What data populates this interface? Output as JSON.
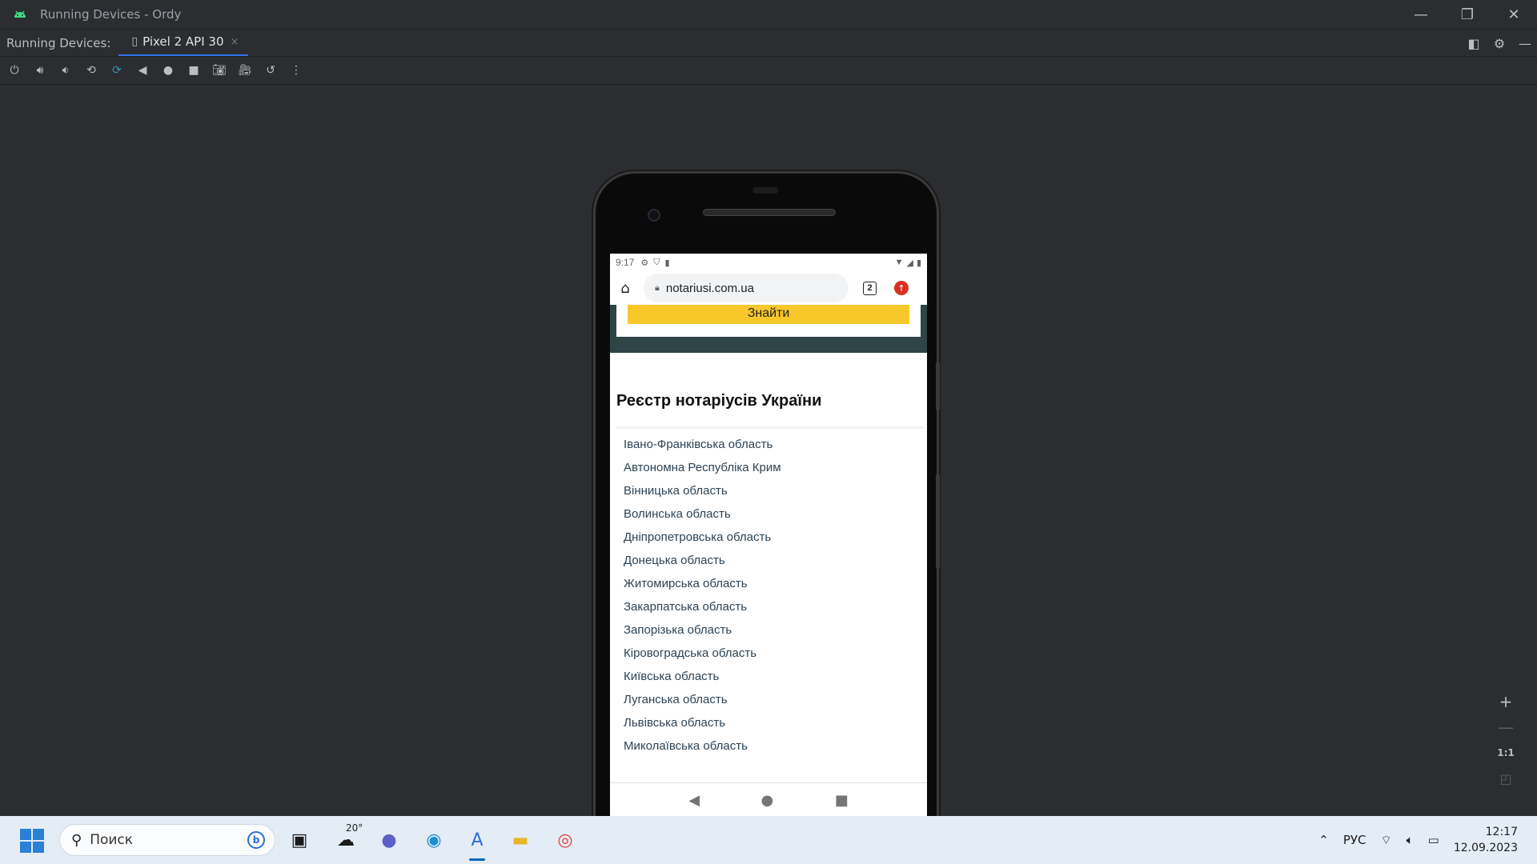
{
  "window": {
    "title": "Running Devices - Ordy",
    "minimize": "—",
    "restore": "❐",
    "close": "✕"
  },
  "tabbar": {
    "label": "Running Devices:",
    "tab_label": "Pixel 2 API 30",
    "tab_close": "×"
  },
  "phone": {
    "status_time": "9:17",
    "url": "notariusi.com.ua",
    "tabs_count": "2",
    "search_button": "Знайти",
    "registry_title": "Реєстр нотаріусів України",
    "regions": [
      "Івано-Франківська область",
      "Автономна Республіка Крим",
      "Вінницька область",
      "Волинська область",
      "Дніпропетровська область",
      "Донецька область",
      "Житомирська область",
      "Закарпатська область",
      "Запорізька область",
      "Кіровоградська область",
      "Київська область",
      "Луганська область",
      "Львівська область",
      "Миколаївська область"
    ]
  },
  "zoom": {
    "zoom_in": "+",
    "zoom_out": "—",
    "one_to_one": "1:1"
  },
  "taskbar": {
    "search_placeholder": "Поиск",
    "weather_temp": "20°",
    "language": "РУС",
    "time": "12:17",
    "date": "12.09.2023"
  },
  "colors": {
    "ide_background": "#2b2d30",
    "accent": "#3574f0",
    "search_button_bg": "#f8c72a",
    "hero_bg": "#2f4446",
    "link_color": "#2d4354",
    "taskbar_bg": "#e4ecf6"
  }
}
